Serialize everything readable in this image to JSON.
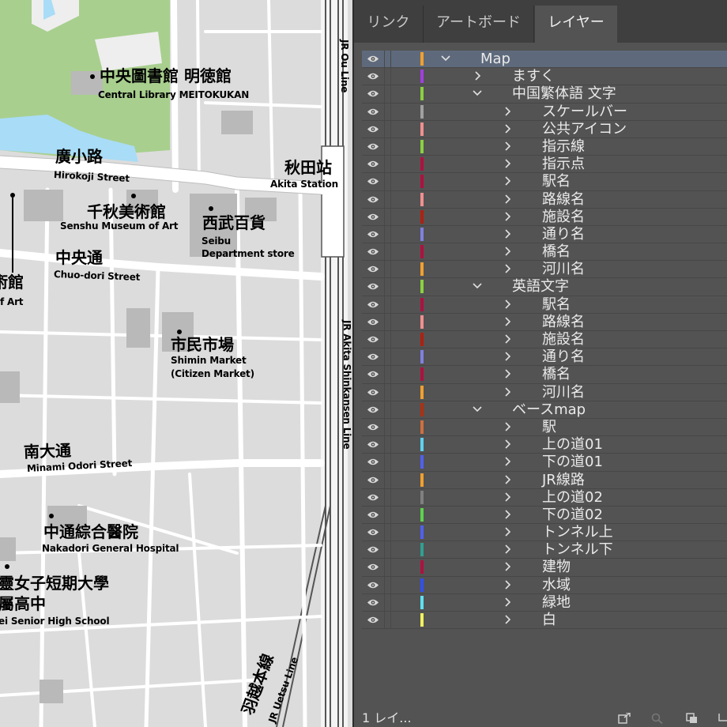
{
  "map": {
    "labels": {
      "library_jp": "中央圖書館 明徳館",
      "library_en": "Central Library MEITOKUKAN",
      "hirokoji_jp": "廣小路",
      "hirokoji_en": "Hirokoji Street",
      "akita_station_jp": "秋田站",
      "akita_station_en": "Akita Station",
      "senshu_jp": "千秋美術館",
      "senshu_en": "Senshu Museum of Art",
      "seibu_jp": "西武百貨",
      "seibu_en1": "Seibu",
      "seibu_en2": "Department store",
      "chuo_jp": "中央通",
      "chuo_en": "Chuo-dori Street",
      "museum_partial_jp": "術館",
      "museum_partial_en": "f Art",
      "shimin_jp": "市民市場",
      "shimin_en1": "Shimin Market",
      "shimin_en2": "(Citizen Market)",
      "minami_jp": "南大通",
      "minami_en": "Minami Odori Street",
      "nakadori_jp": "中通綜合醫院",
      "nakadori_en": "Nakadori General Hospital",
      "college_jp1": "靈女子短期大學",
      "college_jp2": "屬高中",
      "college_en": "ei Senior High School",
      "jr_ou": "JR Ou Line",
      "jr_shinkansen": "JR Akita Shinkansen Line",
      "uetsu_jp": "羽越本線",
      "uetsu_en": "JR Uetsu Line"
    },
    "colors": {
      "background": "#f4f4f4",
      "block": "#dcdcdc",
      "road": "#ffffff",
      "road_edge": "#bdbdbd",
      "green": "#a8cf8e",
      "water": "#a9dcf6",
      "building": "#b9b9b9"
    }
  },
  "panel": {
    "tabs": [
      {
        "label": "リンク",
        "active": false
      },
      {
        "label": "アートボード",
        "active": false
      },
      {
        "label": "レイヤー",
        "active": true
      }
    ],
    "layers": [
      {
        "name": "Map",
        "level": 0,
        "expanded": true,
        "color": "#f0a030",
        "selected": true
      },
      {
        "name": "ますく",
        "level": 1,
        "expanded": false,
        "color": "#a040e0"
      },
      {
        "name": "中国繁体語 文字",
        "level": 1,
        "expanded": true,
        "color": "#8ad040"
      },
      {
        "name": "スケールバー",
        "level": 2,
        "expanded": false,
        "color": "#a0a0a0"
      },
      {
        "name": "公共アイコン",
        "level": 2,
        "expanded": false,
        "color": "#f09090"
      },
      {
        "name": "指示線",
        "level": 2,
        "expanded": false,
        "color": "#8ad040"
      },
      {
        "name": "指示点",
        "level": 2,
        "expanded": false,
        "color": "#b01040"
      },
      {
        "name": "駅名",
        "level": 2,
        "expanded": false,
        "color": "#b01040"
      },
      {
        "name": "路線名",
        "level": 2,
        "expanded": false,
        "color": "#f09090"
      },
      {
        "name": "施設名",
        "level": 2,
        "expanded": false,
        "color": "#b02010"
      },
      {
        "name": "通り名",
        "level": 2,
        "expanded": false,
        "color": "#8080e0"
      },
      {
        "name": "橋名",
        "level": 2,
        "expanded": false,
        "color": "#b01040"
      },
      {
        "name": "河川名",
        "level": 2,
        "expanded": false,
        "color": "#f0a030"
      },
      {
        "name": "英語文字",
        "level": 1,
        "expanded": true,
        "color": "#8ad040"
      },
      {
        "name": "駅名",
        "level": 2,
        "expanded": false,
        "color": "#b01040"
      },
      {
        "name": "路線名",
        "level": 2,
        "expanded": false,
        "color": "#f09090"
      },
      {
        "name": "施設名",
        "level": 2,
        "expanded": false,
        "color": "#b02010"
      },
      {
        "name": "通り名",
        "level": 2,
        "expanded": false,
        "color": "#8080e0"
      },
      {
        "name": "橋名",
        "level": 2,
        "expanded": false,
        "color": "#b01040"
      },
      {
        "name": "河川名",
        "level": 2,
        "expanded": false,
        "color": "#f0a030"
      },
      {
        "name": "ベースmap",
        "level": 1,
        "expanded": true,
        "color": "#b03010"
      },
      {
        "name": "駅",
        "level": 2,
        "expanded": false,
        "color": "#d07040"
      },
      {
        "name": "上の道01",
        "level": 2,
        "expanded": false,
        "color": "#60d0f0"
      },
      {
        "name": "下の道01",
        "level": 2,
        "expanded": false,
        "color": "#5060f0"
      },
      {
        "name": "JR線路",
        "level": 2,
        "expanded": false,
        "color": "#f0a030"
      },
      {
        "name": "上の道02",
        "level": 2,
        "expanded": false,
        "color": "#808080"
      },
      {
        "name": "下の道02",
        "level": 2,
        "expanded": false,
        "color": "#60d050"
      },
      {
        "name": "トンネル上",
        "level": 2,
        "expanded": false,
        "color": "#5060f0"
      },
      {
        "name": "トンネル下",
        "level": 2,
        "expanded": false,
        "color": "#30a090"
      },
      {
        "name": "建物",
        "level": 2,
        "expanded": false,
        "color": "#b01040"
      },
      {
        "name": "水域",
        "level": 2,
        "expanded": false,
        "color": "#3050f0"
      },
      {
        "name": "緑地",
        "level": 2,
        "expanded": false,
        "color": "#60e0f0"
      },
      {
        "name": "白",
        "level": 2,
        "expanded": false,
        "color": "#f0f060"
      }
    ],
    "footer": {
      "count": "1 レイ..."
    },
    "icons": [
      "eye-icon",
      "chevron-right-icon",
      "chevron-down-icon",
      "export-icon",
      "search-icon",
      "clipping-mask-icon",
      "new-sublayer-icon"
    ]
  }
}
